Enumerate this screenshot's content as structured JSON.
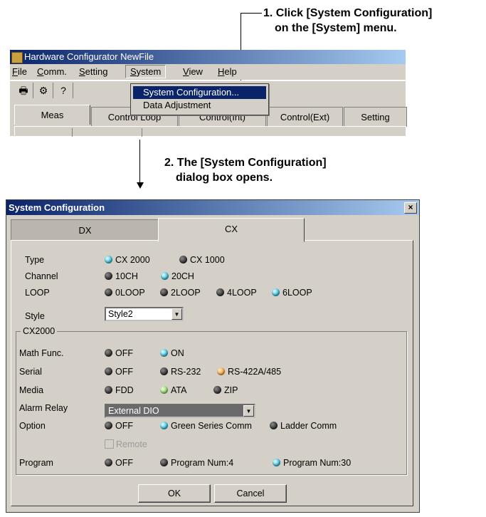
{
  "callouts": {
    "step1_line1": "1. Click [System Configuration]",
    "step1_line2": "on the [System] menu.",
    "step2_line1": "2. The [System Configuration]",
    "step2_line2": "dialog box opens."
  },
  "main_window": {
    "title": "Hardware Configurator NewFile",
    "menu": {
      "file": "File",
      "comm": "Comm.",
      "setting": "Setting",
      "system": "System",
      "view": "View",
      "help": "Help"
    },
    "system_menu_items": [
      "System Configuration...",
      "Data Adjustment"
    ],
    "tabs": [
      "Meas",
      "Control Loop",
      "Control(Int)",
      "Control(Ext)",
      "Setting"
    ]
  },
  "dialog": {
    "title": "System Configuration",
    "close_glyph": "×",
    "tabs": [
      "DX",
      "CX"
    ],
    "active_tab": "CX",
    "rows": {
      "type": {
        "label": "Type",
        "options": [
          "CX 2000",
          "CX 1000"
        ],
        "selected": "CX 2000"
      },
      "channel": {
        "label": "Channel",
        "options": [
          "10CH",
          "20CH"
        ],
        "selected": "20CH"
      },
      "loop": {
        "label": "LOOP",
        "options": [
          "0LOOP",
          "2LOOP",
          "4LOOP",
          "6LOOP"
        ],
        "selected": "6LOOP"
      },
      "style": {
        "label": "Style",
        "value": "Style2"
      }
    },
    "group_label": "CX2000",
    "group_rows": {
      "math": {
        "label": "Math Func.",
        "options": [
          "OFF",
          "ON"
        ],
        "selected": "ON"
      },
      "serial": {
        "label": "Serial",
        "options": [
          "OFF",
          "RS-232",
          "RS-422A/485"
        ],
        "selected": "RS-422A/485"
      },
      "media": {
        "label": "Media",
        "options": [
          "FDD",
          "ATA",
          "ZIP"
        ],
        "selected": "ATA"
      },
      "alarm_relay": {
        "label": "Alarm Relay",
        "value": "External DIO"
      },
      "option": {
        "label": "Option",
        "options": [
          "OFF",
          "Green Series Comm",
          "Ladder Comm"
        ],
        "selected": "Green Series Comm"
      },
      "remote": {
        "label": "Remote"
      }
    },
    "program": {
      "label": "Program",
      "options": [
        "OFF",
        "Program Num:4",
        "Program Num:30"
      ],
      "selected": "Program Num:30"
    },
    "ok": "OK",
    "cancel": "Cancel"
  },
  "colors": {
    "titlebar": "#0a246a",
    "selected_radio": "#3db8d8",
    "highlight_menu": "#0a246a"
  }
}
